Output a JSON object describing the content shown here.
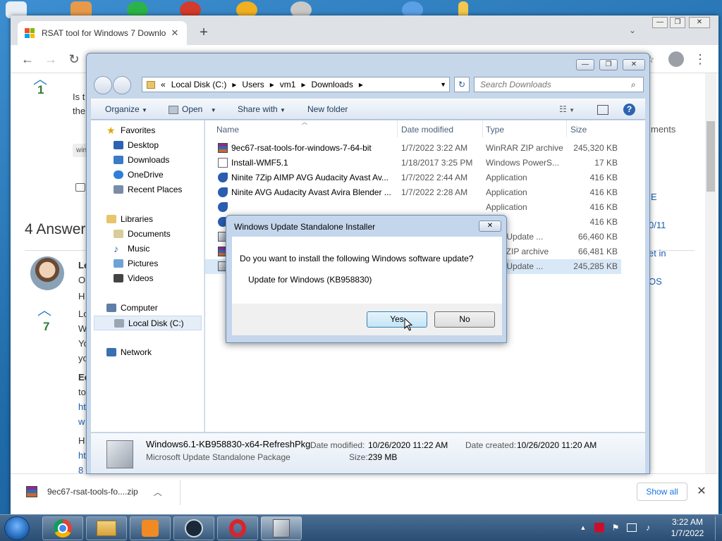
{
  "browser": {
    "tab_title": "RSAT tool for Windows 7 Downlo",
    "new_tab": "+",
    "page": {
      "vote_top": "1",
      "question_snippet_1": "Is t",
      "question_snippet_2": "the",
      "tag_snippet": "win",
      "answers_heading": "4 Answer",
      "answer_vote": "7",
      "answer_lines": [
        "Le",
        "O",
        "H",
        "Lo",
        "W",
        "Yo",
        "yo",
        "Ec",
        "to",
        "ht",
        "w",
        "H",
        "ht",
        "8"
      ],
      "side_text": "ments",
      "side_links": [
        "E",
        "0/11",
        "et in",
        "OS"
      ]
    },
    "download": {
      "filename": "9ec67-rsat-tools-fo....zip",
      "show_all": "Show all"
    }
  },
  "explorer": {
    "breadcrumb": [
      "Local Disk (C:)",
      "Users",
      "vm1",
      "Downloads"
    ],
    "search_placeholder": "Search Downloads",
    "commands": {
      "organize": "Organize",
      "open": "Open",
      "share": "Share with",
      "new_folder": "New folder"
    },
    "nav": {
      "favorites": "Favorites",
      "desktop": "Desktop",
      "downloads": "Downloads",
      "onedrive": "OneDrive",
      "recent": "Recent Places",
      "libraries": "Libraries",
      "documents": "Documents",
      "music": "Music",
      "pictures": "Pictures",
      "videos": "Videos",
      "computer": "Computer",
      "local_disk": "Local Disk (C:)",
      "network": "Network"
    },
    "columns": {
      "name": "Name",
      "date": "Date modified",
      "type": "Type",
      "size": "Size"
    },
    "files": [
      {
        "name": "9ec67-rsat-tools-for-windows-7-64-bit",
        "date": "1/7/2022 3:22 AM",
        "type": "WinRAR ZIP archive",
        "size": "245,320 KB",
        "icon": "rar-icon"
      },
      {
        "name": "Install-WMF5.1",
        "date": "1/18/2017 3:25 PM",
        "type": "Windows PowerS...",
        "size": "17 KB",
        "icon": "script-icon"
      },
      {
        "name": "Ninite 7Zip AIMP AVG Audacity Avast Av...",
        "date": "1/7/2022 2:44 AM",
        "type": "Application",
        "size": "416 KB",
        "icon": "ninite-icon"
      },
      {
        "name": "Ninite AVG Audacity Avast Avira Blender ...",
        "date": "1/7/2022 2:28 AM",
        "type": "Application",
        "size": "416 KB",
        "icon": "ninite-icon"
      },
      {
        "name": "",
        "date": "",
        "type": "Application",
        "size": "416 KB",
        "icon": "ninite-icon"
      },
      {
        "name": "",
        "date": "",
        "type": "",
        "size": "416 KB",
        "icon": "ninite-icon"
      },
      {
        "name": "",
        "date": "",
        "type": "osoft Update ...",
        "size": "66,460 KB",
        "icon": "msu-icon"
      },
      {
        "name": "",
        "date": "",
        "type": "RAR ZIP archive",
        "size": "66,481 KB",
        "icon": "rar-icon"
      },
      {
        "name": "",
        "date": "",
        "type": "osoft Update ...",
        "size": "245,285 KB",
        "icon": "msu-icon"
      }
    ],
    "details": {
      "filename": "Windows6.1-KB958830-x64-RefreshPkg",
      "filetype": "Microsoft Update Standalone Package",
      "date_modified_label": "Date modified:",
      "date_modified": "10/26/2020 11:22 AM",
      "date_created_label": "Date created:",
      "date_created": "10/26/2020 11:20 AM",
      "size_label": "Size:",
      "size": "239 MB"
    }
  },
  "dialog": {
    "title": "Windows Update Standalone Installer",
    "question": "Do you want to install the following Windows software update?",
    "update_name": "Update for Windows (KB958830)",
    "yes": "Yes",
    "no": "No"
  },
  "taskbar": {
    "time": "3:22 AM",
    "date": "1/7/2022"
  },
  "colors": {
    "accent": "#1a73e8",
    "vote_green": "#2e7d32",
    "link_blue": "#1a5fb4",
    "explorer_frame": "#c6d7ea"
  }
}
